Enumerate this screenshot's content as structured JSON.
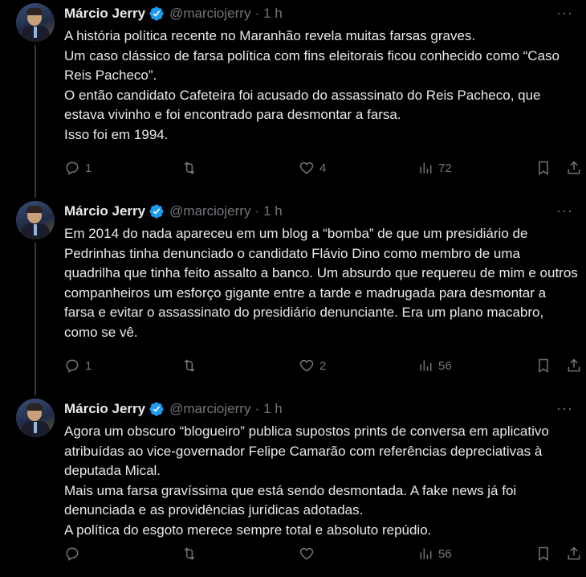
{
  "tweets": [
    {
      "author": "Márcio Jerry",
      "handle": "@marciojerry",
      "time": "1 h",
      "more": "···",
      "paragraphs": [
        "A história política recente no Maranhão revela muitas farsas graves.",
        "Um caso clássico de farsa política com fins eleitorais ficou conhecido como “Caso Reis Pacheco”.",
        "O então candidato Cafeteira foi acusado do assassinato do Reis Pacheco, que estava vivinho e foi encontrado para desmontar a farsa.",
        "Isso foi em 1994."
      ],
      "replies": "1",
      "retweets": "",
      "likes": "4",
      "views": "72"
    },
    {
      "author": "Márcio Jerry",
      "handle": "@marciojerry",
      "time": "1 h",
      "more": "···",
      "paragraphs": [
        "Em 2014 do nada apareceu em um blog a “bomba” de que um presidiário de Pedrinhas tinha denunciado o candidato Flávio Dino como membro de uma quadrilha que tinha feito assalto a banco. Um absurdo que requereu de mim e outros companheiros um esforço gigante entre a tarde e madrugada para desmontar a farsa e evitar o assassinato do presidiário denunciante. Era um plano macabro, como se vê."
      ],
      "replies": "1",
      "retweets": "",
      "likes": "2",
      "views": "56"
    },
    {
      "author": "Márcio Jerry",
      "handle": "@marciojerry",
      "time": "1 h",
      "more": "···",
      "paragraphs": [
        "Agora um obscuro “blogueiro” publica supostos prints de conversa em aplicativo atribuídas ao vice-governador Felipe Camarão com referências depreciativas à deputada Mical.",
        "Mais uma farsa gravíssima que está sendo desmontada. A fake news já foi denunciada e as providências jurídicas adotadas.",
        "A política do esgoto merece sempre total e absoluto repúdio."
      ],
      "replies": "",
      "retweets": "",
      "likes": "",
      "views": "56"
    }
  ],
  "icons": {
    "verified": "verified-badge-icon",
    "reply": "reply-icon",
    "retweet": "retweet-icon",
    "like": "heart-icon",
    "views": "views-icon",
    "bookmark": "bookmark-icon",
    "share": "share-icon"
  },
  "colors": {
    "background": "#000000",
    "text": "#e7e9ea",
    "muted": "#71767b",
    "verified": "#1d9bf0"
  }
}
